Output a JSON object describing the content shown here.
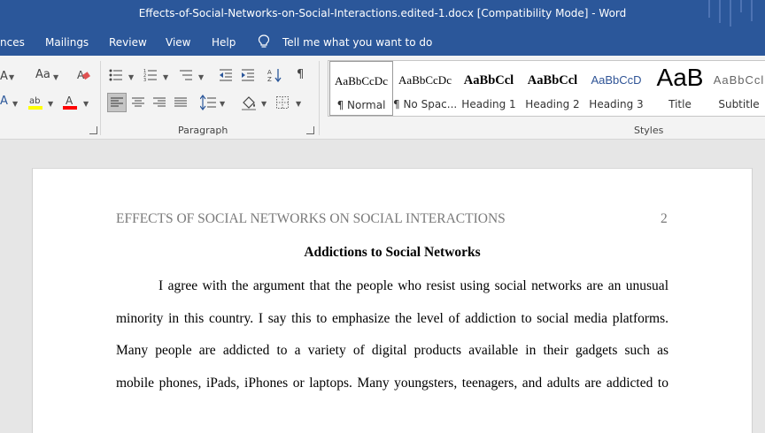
{
  "window": {
    "title": "Effects-of-Social-Networks-on-Social-Interactions.edited-1.docx [Compatibility Mode]  -  Word"
  },
  "tabs": [
    {
      "label": "nces"
    },
    {
      "label": "Mailings"
    },
    {
      "label": "Review"
    },
    {
      "label": "View"
    },
    {
      "label": "Help"
    }
  ],
  "tell_me": {
    "label": "Tell me what you want to do"
  },
  "ribbon": {
    "paragraph_label": "Paragraph",
    "styles_label": "Styles",
    "font": {
      "change_case": "Aa",
      "shrink": "A"
    },
    "styles": [
      {
        "sample": "AaBbCcDc",
        "name": "¶ Normal"
      },
      {
        "sample": "AaBbCcDc",
        "name": "¶ No Spac..."
      },
      {
        "sample": "AaBbCcl",
        "name": "Heading 1"
      },
      {
        "sample": "AaBbCcl",
        "name": "Heading 2"
      },
      {
        "sample": "AaBbCcD",
        "name": "Heading 3"
      },
      {
        "sample": "AaB",
        "name": "Title"
      },
      {
        "sample": "AaBbCcl",
        "name": "Subtitle"
      }
    ]
  },
  "document": {
    "running_head": "EFFECTS OF SOCIAL NETWORKS ON SOCIAL INTERACTIONS",
    "page_number": "2",
    "heading": "Addictions to Social Networks",
    "lines": [
      "I agree with the argument that the people who resist using social networks are an unusual",
      "minority in this country. I say this to emphasize the level of addiction to social media platforms.",
      "Many people are addicted to a variety of digital products available in their gadgets such as",
      "mobile phones, iPads, iPhones or laptops. Many youngsters, teenagers, and adults are addicted to"
    ]
  },
  "colors": {
    "title_bar": "#2b579a",
    "ribbon": "#f3f3f3",
    "canvas": "#e6e6e6",
    "heading_blue": "#2f5496",
    "highlight": "#ffff00",
    "font_color": "#ff0000"
  }
}
